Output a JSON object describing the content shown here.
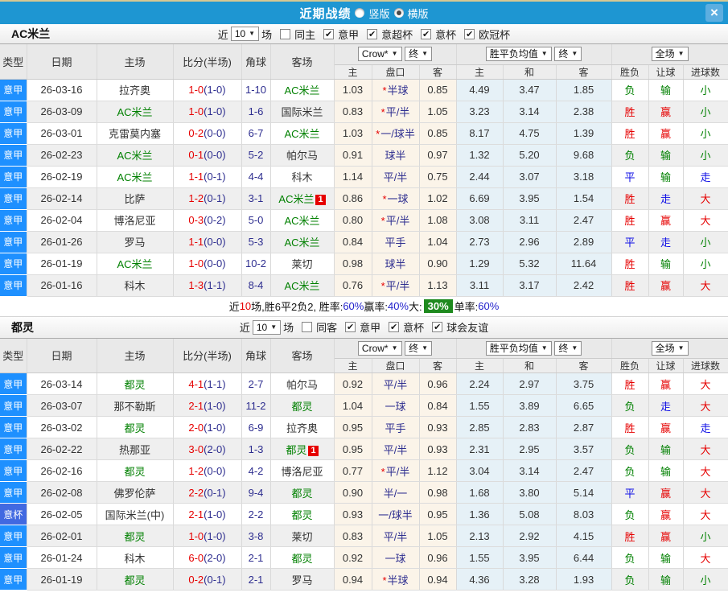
{
  "titlebar": {
    "title": "近期战绩",
    "radios": [
      {
        "label": "竖版",
        "selected": false
      },
      {
        "label": "横版",
        "selected": true
      }
    ],
    "close": "×"
  },
  "colors": {
    "titlebar_blue": "#1E96D2",
    "league_serie_a_blue": "#1E90FF",
    "cup_royal_blue": "#4169E1",
    "team_highlight_green": "#008000",
    "win_red": "#E60000",
    "draw_blue": "#0F0FE6",
    "loss_green": "#008000",
    "halftime_navy": "#2D2D8F",
    "handicap_bg_cream": "#FBF4E9",
    "odds_bg_lightblue": "#E6F1F7",
    "summary_badge_green": "#1E8A1E"
  },
  "table_header": {
    "cols": [
      "类型",
      "日期",
      "主场",
      "比分(半场)",
      "角球",
      "客场"
    ],
    "bookmaker": "Crow*",
    "final1": "终",
    "odds_label": "胜平负均值",
    "final2": "终",
    "scope": "全场",
    "sub": [
      "主",
      "盘口",
      "客",
      "主",
      "和",
      "客",
      "胜负",
      "让球",
      "进球数"
    ]
  },
  "sections": [
    {
      "team": "AC米兰",
      "filter": {
        "prefix": "近",
        "count": "10",
        "suffix": "场",
        "same": {
          "label": "同主",
          "checked": false
        },
        "leagues": [
          {
            "label": "意甲",
            "checked": true
          },
          {
            "label": "意超杯",
            "checked": true
          },
          {
            "label": "意杯",
            "checked": true
          },
          {
            "label": "欧冠杯",
            "checked": true
          }
        ]
      },
      "rows": [
        {
          "type": "意甲",
          "cup": false,
          "date": "26-03-16",
          "home": "拉齐奥",
          "homeSelf": false,
          "ft": "1-0",
          "ht": "(1-0)",
          "corner": "1-10",
          "away": "AC米兰",
          "awaySelf": true,
          "badge": "",
          "oh": "1.03",
          "star": true,
          "hc": "半球",
          "oa": "0.85",
          "m1": "4.49",
          "m2": "3.47",
          "m3": "1.85",
          "res": "负",
          "resC": "g",
          "let": "输",
          "letC": "g",
          "goal": "小",
          "goalC": "g"
        },
        {
          "type": "意甲",
          "cup": false,
          "date": "26-03-09",
          "home": "AC米兰",
          "homeSelf": true,
          "ft": "1-0",
          "ht": "(1-0)",
          "corner": "1-6",
          "away": "国际米兰",
          "awaySelf": false,
          "badge": "",
          "oh": "0.83",
          "star": true,
          "hc": "平/半",
          "oa": "1.05",
          "m1": "3.23",
          "m2": "3.14",
          "m3": "2.38",
          "res": "胜",
          "resC": "r",
          "let": "赢",
          "letC": "r",
          "goal": "小",
          "goalC": "g"
        },
        {
          "type": "意甲",
          "cup": false,
          "date": "26-03-01",
          "home": "克雷莫内塞",
          "homeSelf": false,
          "ft": "0-2",
          "ht": "(0-0)",
          "corner": "6-7",
          "away": "AC米兰",
          "awaySelf": true,
          "badge": "",
          "oh": "1.03",
          "star": true,
          "hc": "一/球半",
          "oa": "0.85",
          "m1": "8.17",
          "m2": "4.75",
          "m3": "1.39",
          "res": "胜",
          "resC": "r",
          "let": "赢",
          "letC": "r",
          "goal": "小",
          "goalC": "g"
        },
        {
          "type": "意甲",
          "cup": false,
          "date": "26-02-23",
          "home": "AC米兰",
          "homeSelf": true,
          "ft": "0-1",
          "ht": "(0-0)",
          "corner": "5-2",
          "away": "帕尔马",
          "awaySelf": false,
          "badge": "",
          "oh": "0.91",
          "star": false,
          "hc": "球半",
          "oa": "0.97",
          "m1": "1.32",
          "m2": "5.20",
          "m3": "9.68",
          "res": "负",
          "resC": "g",
          "let": "输",
          "letC": "g",
          "goal": "小",
          "goalC": "g"
        },
        {
          "type": "意甲",
          "cup": false,
          "date": "26-02-19",
          "home": "AC米兰",
          "homeSelf": true,
          "ft": "1-1",
          "ht": "(0-1)",
          "corner": "4-4",
          "away": "科木",
          "awaySelf": false,
          "badge": "",
          "oh": "1.14",
          "star": false,
          "hc": "平/半",
          "oa": "0.75",
          "m1": "2.44",
          "m2": "3.07",
          "m3": "3.18",
          "res": "平",
          "resC": "b",
          "let": "输",
          "letC": "g",
          "goal": "走",
          "goalC": "b"
        },
        {
          "type": "意甲",
          "cup": false,
          "date": "26-02-14",
          "home": "比萨",
          "homeSelf": false,
          "ft": "1-2",
          "ht": "(0-1)",
          "corner": "3-1",
          "away": "AC米兰",
          "awaySelf": true,
          "badge": "1",
          "oh": "0.86",
          "star": true,
          "hc": "一球",
          "oa": "1.02",
          "m1": "6.69",
          "m2": "3.95",
          "m3": "1.54",
          "res": "胜",
          "resC": "r",
          "let": "走",
          "letC": "b",
          "goal": "大",
          "goalC": "r"
        },
        {
          "type": "意甲",
          "cup": false,
          "date": "26-02-04",
          "home": "博洛尼亚",
          "homeSelf": false,
          "ft": "0-3",
          "ht": "(0-2)",
          "corner": "5-0",
          "away": "AC米兰",
          "awaySelf": true,
          "badge": "",
          "oh": "0.80",
          "star": true,
          "hc": "平/半",
          "oa": "1.08",
          "m1": "3.08",
          "m2": "3.11",
          "m3": "2.47",
          "res": "胜",
          "resC": "r",
          "let": "赢",
          "letC": "r",
          "goal": "大",
          "goalC": "r"
        },
        {
          "type": "意甲",
          "cup": false,
          "date": "26-01-26",
          "home": "罗马",
          "homeSelf": false,
          "ft": "1-1",
          "ht": "(0-0)",
          "corner": "5-3",
          "away": "AC米兰",
          "awaySelf": true,
          "badge": "",
          "oh": "0.84",
          "star": false,
          "hc": "平手",
          "oa": "1.04",
          "m1": "2.73",
          "m2": "2.96",
          "m3": "2.89",
          "res": "平",
          "resC": "b",
          "let": "走",
          "letC": "b",
          "goal": "小",
          "goalC": "g"
        },
        {
          "type": "意甲",
          "cup": false,
          "date": "26-01-19",
          "home": "AC米兰",
          "homeSelf": true,
          "ft": "1-0",
          "ht": "(0-0)",
          "corner": "10-2",
          "away": "莱切",
          "awaySelf": false,
          "badge": "",
          "oh": "0.98",
          "star": false,
          "hc": "球半",
          "oa": "0.90",
          "m1": "1.29",
          "m2": "5.32",
          "m3": "11.64",
          "res": "胜",
          "resC": "r",
          "let": "输",
          "letC": "g",
          "goal": "小",
          "goalC": "g"
        },
        {
          "type": "意甲",
          "cup": false,
          "date": "26-01-16",
          "home": "科木",
          "homeSelf": false,
          "ft": "1-3",
          "ht": "(1-1)",
          "corner": "8-4",
          "away": "AC米兰",
          "awaySelf": true,
          "badge": "",
          "oh": "0.76",
          "star": true,
          "hc": "平/半",
          "oa": "1.13",
          "m1": "3.11",
          "m2": "3.17",
          "m3": "2.42",
          "res": "胜",
          "resC": "r",
          "let": "赢",
          "letC": "r",
          "goal": "大",
          "goalC": "r"
        }
      ],
      "summary": [
        {
          "text": "近",
          "cls": "k"
        },
        {
          "text": "10",
          "cls": "red"
        },
        {
          "text": "场,胜6平2负2, 胜率:",
          "cls": "k"
        },
        {
          "text": "60%",
          "cls": "blue"
        },
        {
          "text": " 赢率:",
          "cls": "k"
        },
        {
          "text": "40%",
          "cls": "blue"
        },
        {
          "text": " 大:",
          "cls": "k"
        },
        {
          "text": "30%",
          "cls": "badge"
        },
        {
          "text": " 单率:",
          "cls": "k"
        },
        {
          "text": "60%",
          "cls": "blue"
        }
      ]
    },
    {
      "team": "都灵",
      "filter": {
        "prefix": "近",
        "count": "10",
        "suffix": "场",
        "same": {
          "label": "同客",
          "checked": false
        },
        "leagues": [
          {
            "label": "意甲",
            "checked": true
          },
          {
            "label": "意杯",
            "checked": true
          },
          {
            "label": "球会友谊",
            "checked": true
          }
        ]
      },
      "rows": [
        {
          "type": "意甲",
          "cup": false,
          "date": "26-03-14",
          "home": "都灵",
          "homeSelf": true,
          "ft": "4-1",
          "ht": "(1-1)",
          "corner": "2-7",
          "away": "帕尔马",
          "awaySelf": false,
          "badge": "",
          "oh": "0.92",
          "star": false,
          "hc": "平/半",
          "oa": "0.96",
          "m1": "2.24",
          "m2": "2.97",
          "m3": "3.75",
          "res": "胜",
          "resC": "r",
          "let": "赢",
          "letC": "r",
          "goal": "大",
          "goalC": "r"
        },
        {
          "type": "意甲",
          "cup": false,
          "date": "26-03-07",
          "home": "那不勒斯",
          "homeSelf": false,
          "ft": "2-1",
          "ht": "(1-0)",
          "corner": "11-2",
          "away": "都灵",
          "awaySelf": true,
          "badge": "",
          "oh": "1.04",
          "star": false,
          "hc": "一球",
          "oa": "0.84",
          "m1": "1.55",
          "m2": "3.89",
          "m3": "6.65",
          "res": "负",
          "resC": "g",
          "let": "走",
          "letC": "b",
          "goal": "大",
          "goalC": "r"
        },
        {
          "type": "意甲",
          "cup": false,
          "date": "26-03-02",
          "home": "都灵",
          "homeSelf": true,
          "ft": "2-0",
          "ht": "(1-0)",
          "corner": "6-9",
          "away": "拉齐奥",
          "awaySelf": false,
          "badge": "",
          "oh": "0.95",
          "star": false,
          "hc": "平手",
          "oa": "0.93",
          "m1": "2.85",
          "m2": "2.83",
          "m3": "2.87",
          "res": "胜",
          "resC": "r",
          "let": "赢",
          "letC": "r",
          "goal": "走",
          "goalC": "b"
        },
        {
          "type": "意甲",
          "cup": false,
          "date": "26-02-22",
          "home": "热那亚",
          "homeSelf": false,
          "ft": "3-0",
          "ht": "(2-0)",
          "corner": "1-3",
          "away": "都灵",
          "awaySelf": true,
          "badge": "1",
          "oh": "0.95",
          "star": false,
          "hc": "平/半",
          "oa": "0.93",
          "m1": "2.31",
          "m2": "2.95",
          "m3": "3.57",
          "res": "负",
          "resC": "g",
          "let": "输",
          "letC": "g",
          "goal": "大",
          "goalC": "r"
        },
        {
          "type": "意甲",
          "cup": false,
          "date": "26-02-16",
          "home": "都灵",
          "homeSelf": true,
          "ft": "1-2",
          "ht": "(0-0)",
          "corner": "4-2",
          "away": "博洛尼亚",
          "awaySelf": false,
          "badge": "",
          "oh": "0.77",
          "star": true,
          "hc": "平/半",
          "oa": "1.12",
          "m1": "3.04",
          "m2": "3.14",
          "m3": "2.47",
          "res": "负",
          "resC": "g",
          "let": "输",
          "letC": "g",
          "goal": "大",
          "goalC": "r"
        },
        {
          "type": "意甲",
          "cup": false,
          "date": "26-02-08",
          "home": "佛罗伦萨",
          "homeSelf": false,
          "ft": "2-2",
          "ht": "(0-1)",
          "corner": "9-4",
          "away": "都灵",
          "awaySelf": true,
          "badge": "",
          "oh": "0.90",
          "star": false,
          "hc": "半/一",
          "oa": "0.98",
          "m1": "1.68",
          "m2": "3.80",
          "m3": "5.14",
          "res": "平",
          "resC": "b",
          "let": "赢",
          "letC": "r",
          "goal": "大",
          "goalC": "r"
        },
        {
          "type": "意杯",
          "cup": true,
          "date": "26-02-05",
          "home": "国际米兰(中)",
          "homeSelf": false,
          "ft": "2-1",
          "ht": "(1-0)",
          "corner": "2-2",
          "away": "都灵",
          "awaySelf": true,
          "badge": "",
          "oh": "0.93",
          "star": false,
          "hc": "一/球半",
          "oa": "0.95",
          "m1": "1.36",
          "m2": "5.08",
          "m3": "8.03",
          "res": "负",
          "resC": "g",
          "let": "赢",
          "letC": "r",
          "goal": "大",
          "goalC": "r"
        },
        {
          "type": "意甲",
          "cup": false,
          "date": "26-02-01",
          "home": "都灵",
          "homeSelf": true,
          "ft": "1-0",
          "ht": "(1-0)",
          "corner": "3-8",
          "away": "莱切",
          "awaySelf": false,
          "badge": "",
          "oh": "0.83",
          "star": false,
          "hc": "平/半",
          "oa": "1.05",
          "m1": "2.13",
          "m2": "2.92",
          "m3": "4.15",
          "res": "胜",
          "resC": "r",
          "let": "赢",
          "letC": "r",
          "goal": "小",
          "goalC": "g"
        },
        {
          "type": "意甲",
          "cup": false,
          "date": "26-01-24",
          "home": "科木",
          "homeSelf": false,
          "ft": "6-0",
          "ht": "(2-0)",
          "corner": "2-1",
          "away": "都灵",
          "awaySelf": true,
          "badge": "",
          "oh": "0.92",
          "star": false,
          "hc": "一球",
          "oa": "0.96",
          "m1": "1.55",
          "m2": "3.95",
          "m3": "6.44",
          "res": "负",
          "resC": "g",
          "let": "输",
          "letC": "g",
          "goal": "大",
          "goalC": "r"
        },
        {
          "type": "意甲",
          "cup": false,
          "date": "26-01-19",
          "home": "都灵",
          "homeSelf": true,
          "ft": "0-2",
          "ht": "(0-1)",
          "corner": "2-1",
          "away": "罗马",
          "awaySelf": false,
          "badge": "",
          "oh": "0.94",
          "star": true,
          "hc": "半球",
          "oa": "0.94",
          "m1": "4.36",
          "m2": "3.28",
          "m3": "1.93",
          "res": "负",
          "resC": "g",
          "let": "输",
          "letC": "g",
          "goal": "小",
          "goalC": "g"
        }
      ],
      "summary": null
    }
  ]
}
